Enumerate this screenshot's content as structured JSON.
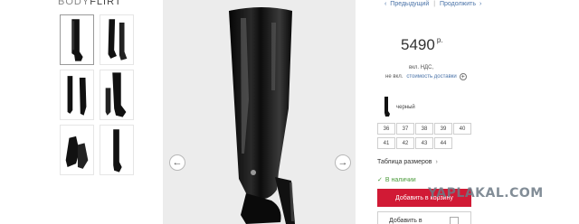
{
  "brand": {
    "part1": "BODY",
    "part2": "FLIRT"
  },
  "navigation": {
    "prev_label": "Предыдущий",
    "divider": "|",
    "next_label": "Продолжить"
  },
  "product": {
    "price": "5490",
    "currency": "р.",
    "vat_note": "вкл. НДС,",
    "delivery_prefix": "не вкл.",
    "delivery_link": "стоимость доставки",
    "color_label": "черный",
    "sizes": [
      "36",
      "37",
      "38",
      "39",
      "40",
      "41",
      "42",
      "43",
      "44"
    ],
    "size_table_label": "Таблица размеров",
    "stock_label": "В наличии",
    "add_to_cart_label": "Добавить в корзину",
    "add_to_fav_label": "Добавить в"
  },
  "watermark": "YAPLAKAL.COM",
  "icons": {
    "prev": "chevron-left-icon",
    "next": "chevron-right-icon",
    "nav_prev_arrow": "arrow-left-icon",
    "nav_next_arrow": "arrow-right-icon",
    "delivery_info": "plus-circle-icon",
    "size_table_chevron": "chevron-right-icon",
    "stock_check": "check-icon"
  },
  "colors": {
    "accent": "#d11a35",
    "link": "#4a73a8",
    "stock": "#4a9a3a"
  }
}
